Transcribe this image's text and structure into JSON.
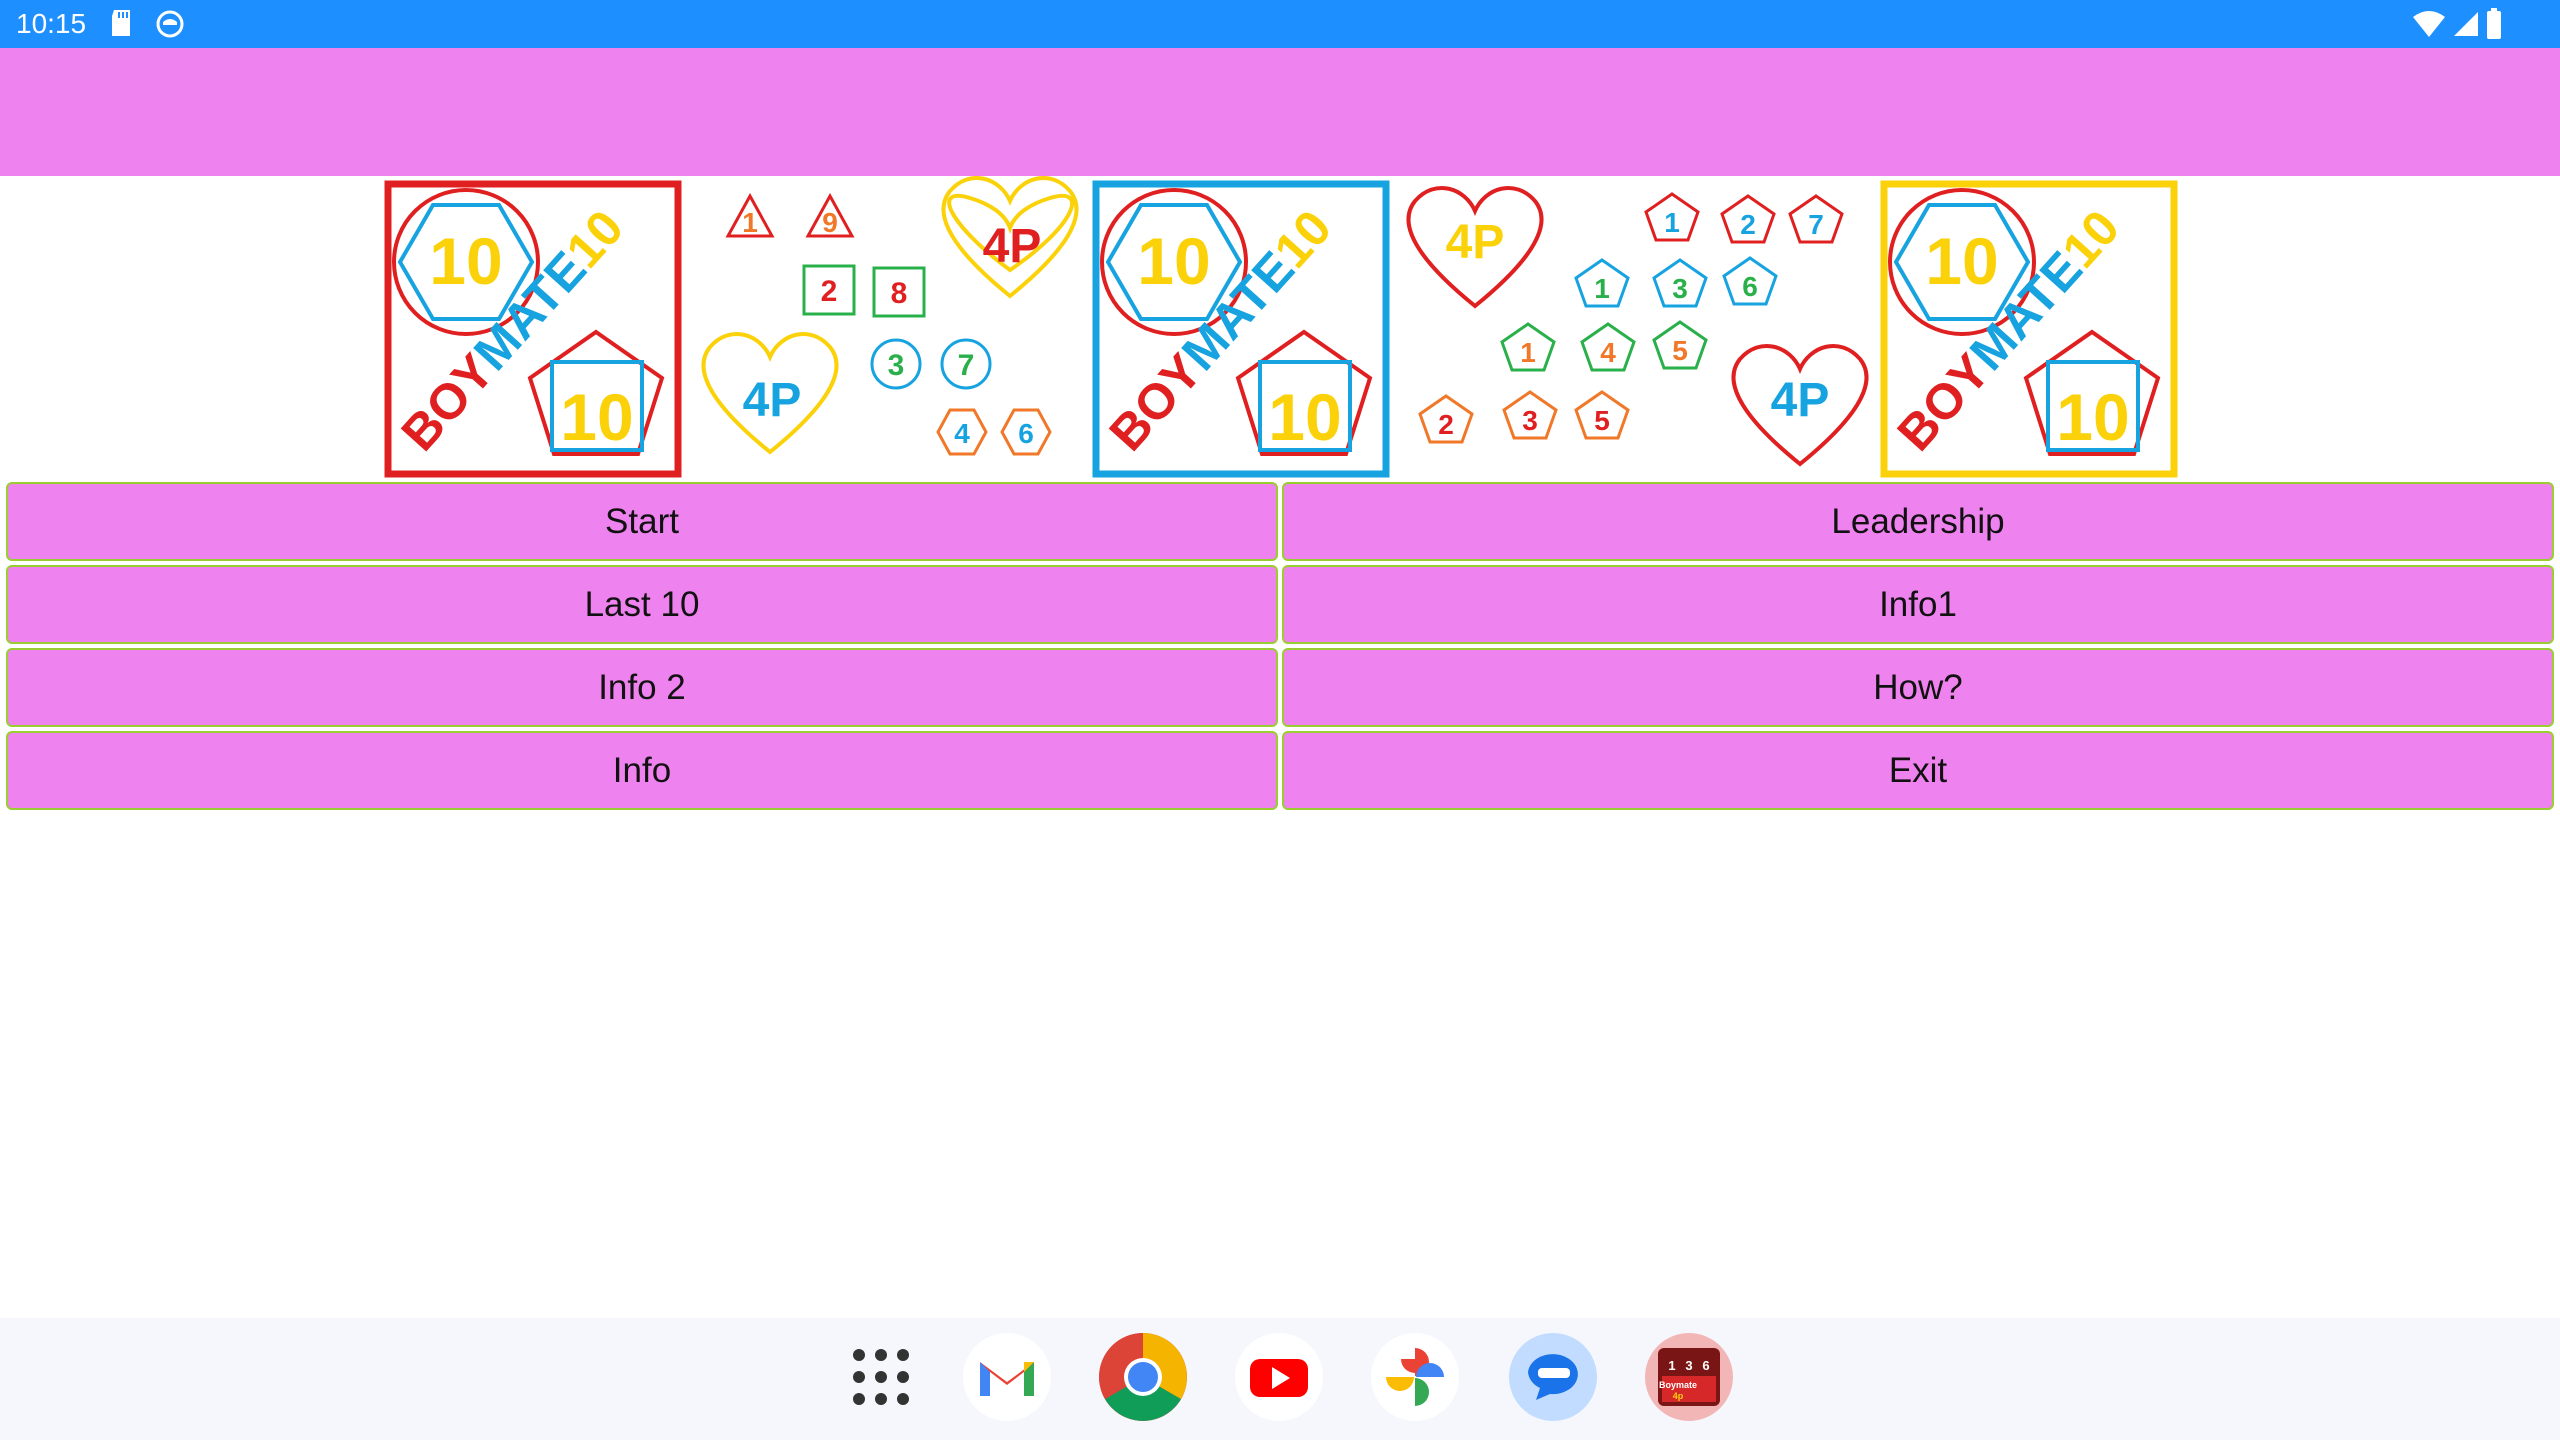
{
  "status_bar": {
    "time": "10:15",
    "icons": [
      "sd-card-icon",
      "notification-circle-icon",
      "wifi-icon",
      "cell-signal-icon",
      "battery-icon"
    ],
    "color": "#1e8ffe"
  },
  "app_bar": {
    "color": "#ee82ee"
  },
  "banner": {
    "logo_number": "10",
    "logo_word_a": "BOY",
    "logo_word_b": "MATE",
    "logo_word_c": "10",
    "heart_label": "4P",
    "tri_numbers": [
      "1",
      "9"
    ],
    "square_numbers": [
      "2",
      "8"
    ],
    "circle_numbers": [
      "3",
      "7"
    ],
    "hex_numbers": [
      "4",
      "6"
    ],
    "pent_row1": [
      "1",
      "2",
      "7"
    ],
    "pent_row2": [
      "1",
      "3",
      "6"
    ],
    "pent_row3": [
      "1",
      "4",
      "5"
    ],
    "pent_row4": [
      "2",
      "3",
      "5"
    ]
  },
  "buttons": {
    "start": "Start",
    "leadership": "Leadership",
    "last10": "Last 10",
    "info1": "Info1",
    "info2": "Info 2",
    "how": "How?",
    "info": "Info",
    "exit": "Exit"
  },
  "colors": {
    "button_bg": "#ee82ee",
    "button_border": "#9acd32",
    "red": "#e02020",
    "blue": "#17a3e0",
    "yellow": "#fbd20a"
  },
  "dock": {
    "apps": [
      "app-drawer-icon",
      "gmail-icon",
      "chrome-icon",
      "youtube-icon",
      "photos-icon",
      "messages-icon",
      "boymate-app-icon"
    ],
    "boymate_text": "Boymate",
    "boymate_sub": "4p",
    "boymate_numbers": [
      "1",
      "3",
      "6"
    ]
  }
}
